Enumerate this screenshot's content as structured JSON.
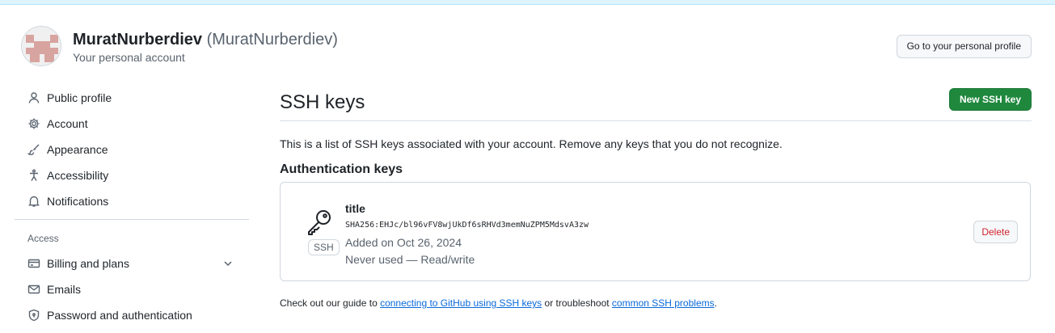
{
  "colors": {
    "accent_link": "#0969da",
    "primary_button": "#1f883d",
    "danger": "#d1242f",
    "muted_text": "#59636e",
    "border": "#d0d7de"
  },
  "header": {
    "name": "MuratNurberdiev",
    "login": "(MuratNurberdiev)",
    "subtitle": "Your personal account",
    "profile_button": "Go to your personal profile"
  },
  "sidebar": {
    "items": [
      {
        "label": "Public profile",
        "icon": "person-icon"
      },
      {
        "label": "Account",
        "icon": "gear-icon"
      },
      {
        "label": "Appearance",
        "icon": "paintbrush-icon"
      },
      {
        "label": "Accessibility",
        "icon": "accessibility-icon"
      },
      {
        "label": "Notifications",
        "icon": "bell-icon"
      }
    ],
    "access_heading": "Access",
    "access_items": [
      {
        "label": "Billing and plans",
        "icon": "credit-card-icon",
        "expandable": true
      },
      {
        "label": "Emails",
        "icon": "mail-icon"
      },
      {
        "label": "Password and authentication",
        "icon": "shield-lock-icon"
      }
    ]
  },
  "main": {
    "title": "SSH keys",
    "new_key_button": "New SSH key",
    "intro": "This is a list of SSH keys associated with your account. Remove any keys that you do not recognize.",
    "section_title": "Authentication keys",
    "keys": [
      {
        "title": "title",
        "type_label": "SSH",
        "icon": "key-icon",
        "fingerprint": "SHA256:EHJc/bl96vFV8wjUkDf6sRHVd3memNuZPM5MdsvA3zw",
        "added": "Added on Oct 26, 2024",
        "usage": "Never used — Read/write",
        "delete_label": "Delete"
      }
    ],
    "guide": {
      "prefix": "Check out our guide to ",
      "link1": "connecting to GitHub using SSH keys",
      "middle": " or troubleshoot ",
      "link2": "common SSH problems",
      "suffix": "."
    }
  }
}
